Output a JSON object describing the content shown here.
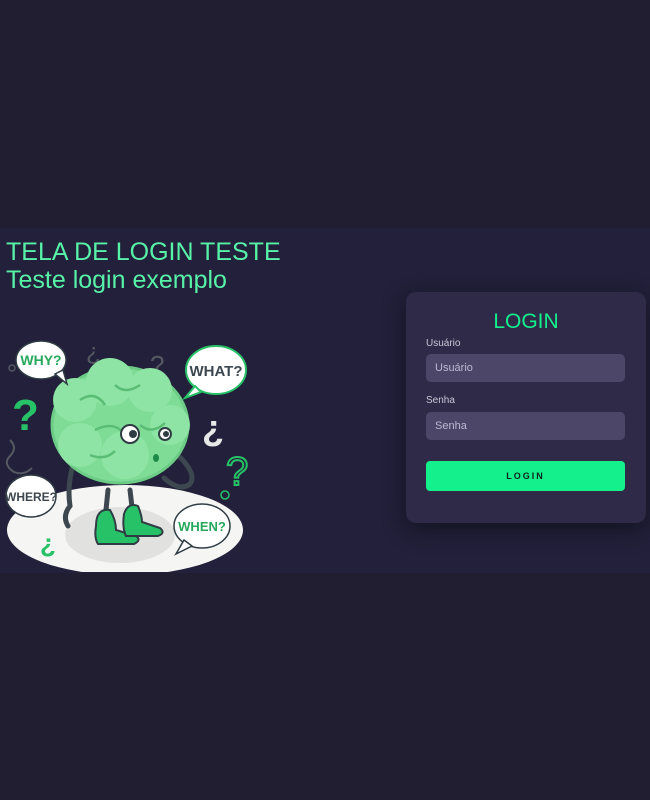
{
  "header": {
    "title": "TELA DE LOGIN TESTE",
    "subtitle": "Teste login exemplo"
  },
  "illustration": {
    "bubbles": [
      "WHY?",
      "WHAT?",
      "WHERE?",
      "WHEN?"
    ],
    "icon": "confused-brain-illustration"
  },
  "login": {
    "title": "LOGIN",
    "username_label": "Usuário",
    "username_placeholder": "Usuário",
    "password_label": "Senha",
    "password_placeholder": "Senha",
    "button_label": "LOGIN"
  },
  "colors": {
    "background": "#201e30",
    "accent": "#13f08c",
    "headline": "#57f2a8",
    "card": "#2f2a47",
    "input": "#4c4768"
  }
}
